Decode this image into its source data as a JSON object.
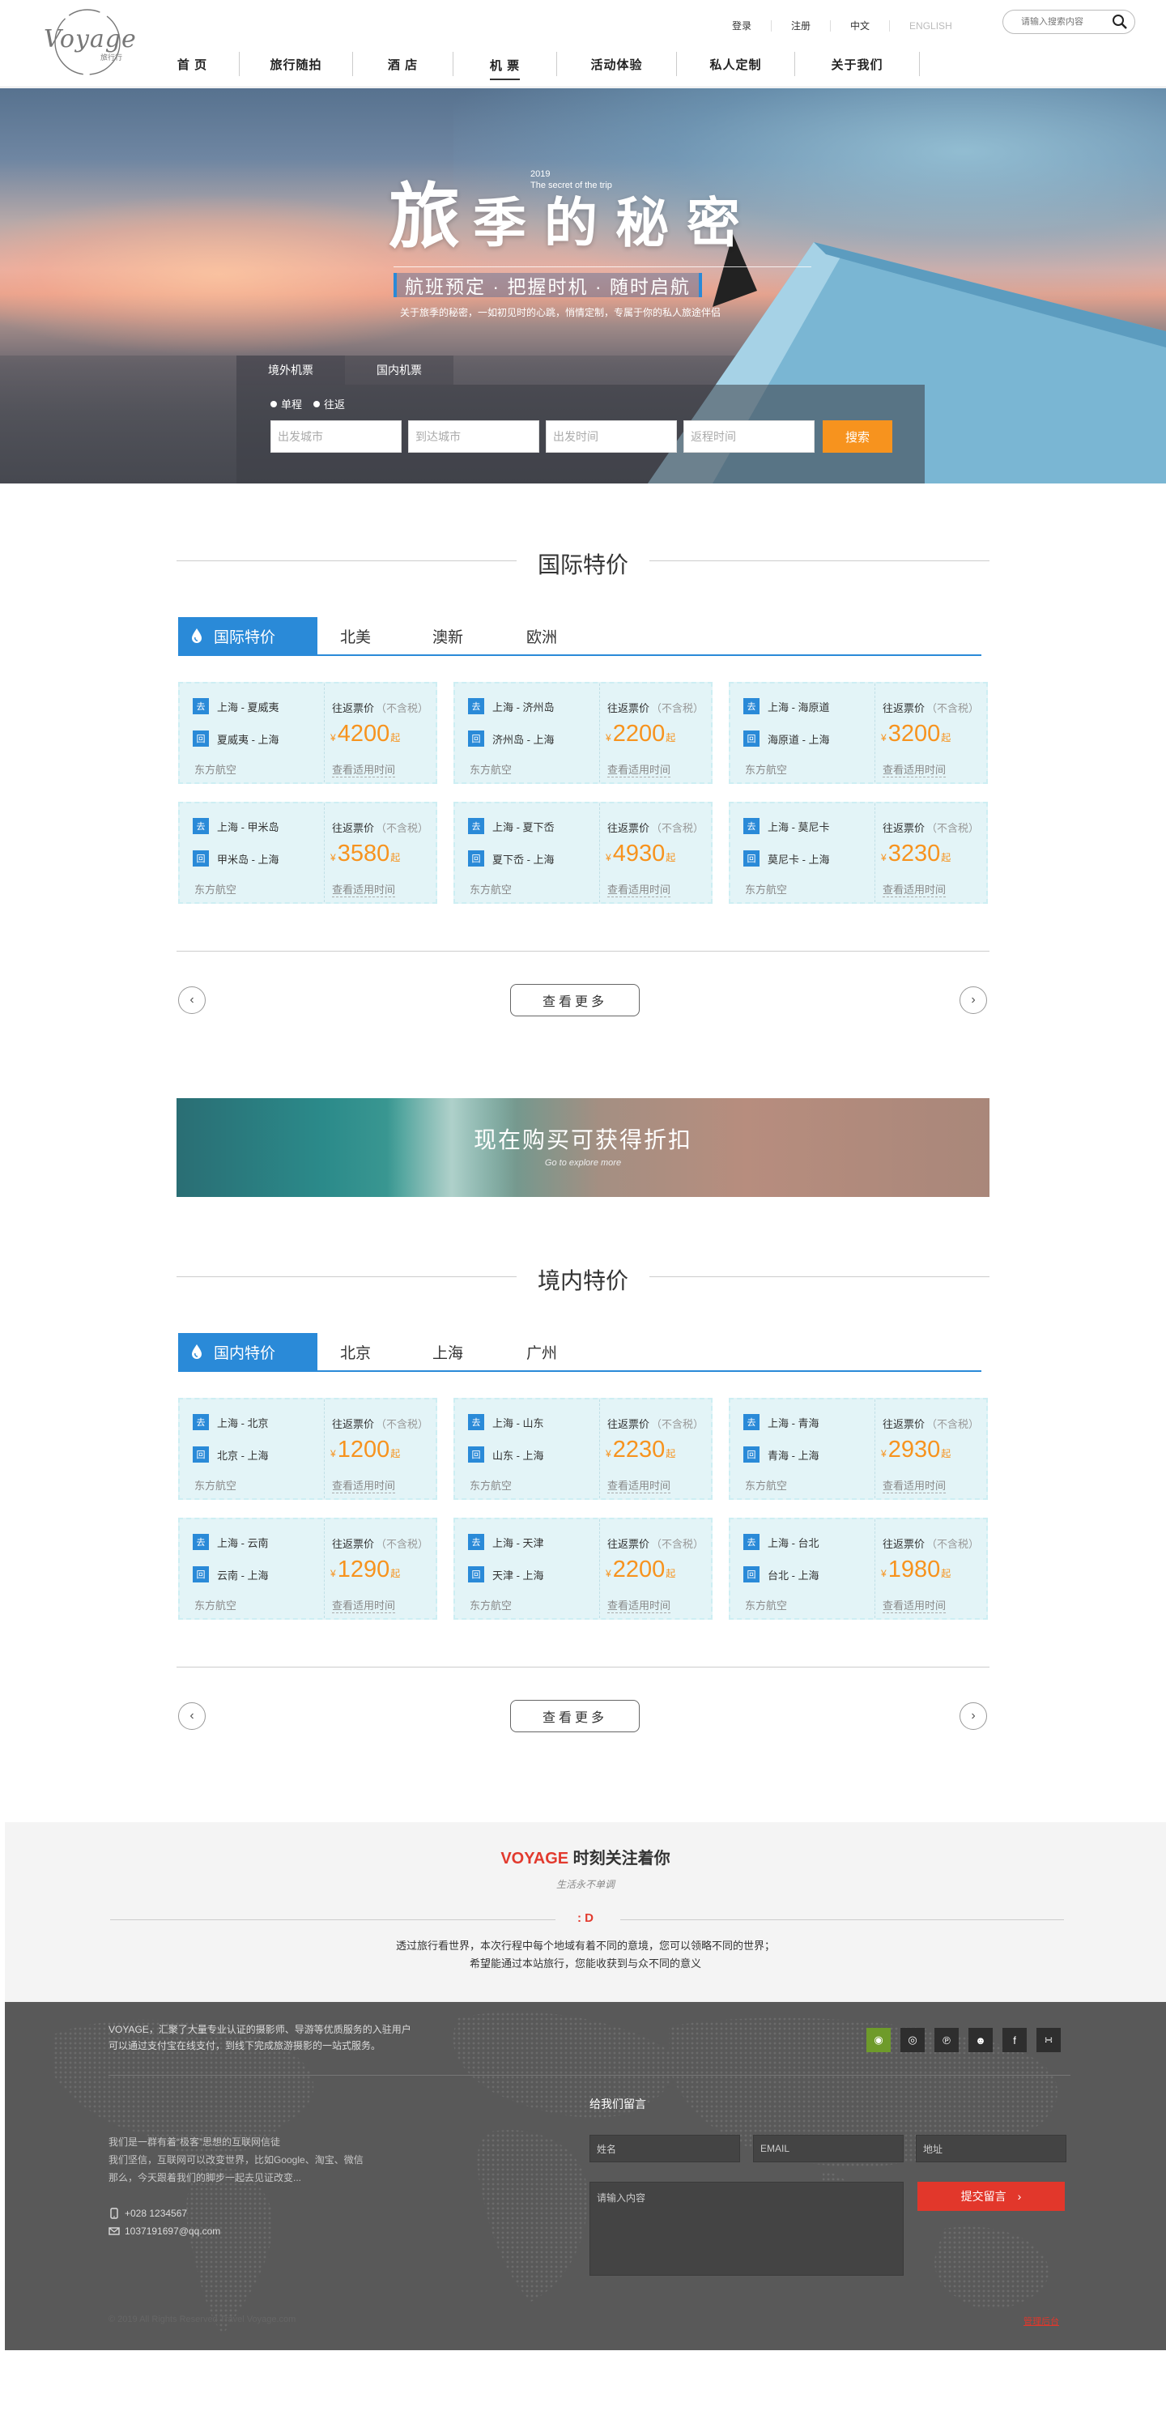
{
  "header": {
    "logo_text": "VOYAGE",
    "logo_sub": "旅行行",
    "top_links": [
      "登录",
      "注册",
      "中文",
      "ENGLISH"
    ],
    "search_placeholder": "请输入搜索内容",
    "nav": [
      "首  页",
      "旅行随拍",
      "酒  店",
      "机  票",
      "活动体验",
      "私人定制",
      "关于我们"
    ],
    "nav_active_index": 3
  },
  "hero": {
    "year": "2019",
    "subtitle_en": "The secret of the trip",
    "title_big": "旅",
    "title_rest": "季的秘密",
    "slogan": "航班预定 · 把握时机 · 随时启航",
    "desc": "关于旅季的秘密，一如初见时的心跳，悄情定制，专属于你的私人旅途伴侣",
    "booking_tabs": [
      "境外机票",
      "国内机票"
    ],
    "radios": [
      "单程",
      "往返"
    ],
    "inputs": [
      "出发城市",
      "到达城市",
      "出发时间",
      "返程时间"
    ],
    "search_button": "搜索"
  },
  "international": {
    "title": "国际特价",
    "tabs": [
      "国际特价",
      "北美",
      "澳新",
      "欧洲"
    ],
    "price_label": "往返票价",
    "tax_note": "（不含税）",
    "check_label": "查看适用时间",
    "go_badge": "去",
    "back_badge": "回",
    "yen": "¥",
    "qi": "起",
    "cards": [
      {
        "go": "上海 - 夏威夷",
        "back": "夏威夷 - 上海",
        "price": "4200",
        "airline": "东方航空"
      },
      {
        "go": "上海 - 济州岛",
        "back": "济州岛 - 上海",
        "price": "2200",
        "airline": "东方航空"
      },
      {
        "go": "上海 - 海原道",
        "back": "海原道 - 上海",
        "price": "3200",
        "airline": "东方航空"
      },
      {
        "go": "上海 - 甲米岛",
        "back": "甲米岛 - 上海",
        "price": "3580",
        "airline": "东方航空"
      },
      {
        "go": "上海 - 夏下岙",
        "back": "夏下岙 - 上海",
        "price": "4930",
        "airline": "东方航空"
      },
      {
        "go": "上海 - 莫尼卡",
        "back": "莫尼卡 - 上海",
        "price": "3230",
        "airline": "东方航空"
      }
    ],
    "more": "查看更多"
  },
  "banner": {
    "title": "现在购买可获得折扣",
    "sub": "Go to explore more"
  },
  "domestic": {
    "title": "境内特价",
    "tabs": [
      "国内特价",
      "北京",
      "上海",
      "广州"
    ],
    "cards": [
      {
        "go": "上海 - 北京",
        "back": "北京 - 上海",
        "price": "1200",
        "airline": "东方航空"
      },
      {
        "go": "上海 - 山东",
        "back": "山东 - 上海",
        "price": "2230",
        "airline": "东方航空"
      },
      {
        "go": "上海 - 青海",
        "back": "青海 - 上海",
        "price": "2930",
        "airline": "东方航空"
      },
      {
        "go": "上海 - 云南",
        "back": "云南 - 上海",
        "price": "1290",
        "airline": "东方航空"
      },
      {
        "go": "上海 - 天津",
        "back": "天津 - 上海",
        "price": "2200",
        "airline": "东方航空"
      },
      {
        "go": "上海 - 台北",
        "back": "台北 - 上海",
        "price": "1980",
        "airline": "东方航空"
      }
    ],
    "more": "查看更多"
  },
  "follow": {
    "brand": "VOYAGE",
    "title_rest": " 时刻关注着你",
    "sub": "生活永不单调",
    "deco": ": D",
    "p1": "透过旅行看世界，本次行程中每个地域有着不同的意境，您可以领略不同的世界；",
    "p2": "希望能通过本站旅行，您能收获到与众不同的意义"
  },
  "footer": {
    "about": "VOYAGE，汇聚了大量专业认证的摄影师、导游等优质服务的入驻用户可以通过支付宝在线支付，到线下完成旅游摄影的一站式服务。",
    "info_lines": [
      "我们是一群有着“极客”思想的互联网信徒",
      "我们坚信，互联网可以改变世界，比如Google、淘宝、微信",
      "那么，今天跟着我们的脚步一起去见证改变..."
    ],
    "phone": "+028 1234567",
    "email": "1037191697@qq.com",
    "social_icons": [
      "weibo-icon",
      "wechat-icon",
      "pinterest-icon",
      "qq-icon",
      "facebook-icon",
      "rss-icon"
    ],
    "message_title": "给我们留言",
    "name_placeholder": "姓名",
    "email_placeholder": "EMAIL",
    "address_placeholder": "地址",
    "content_placeholder": "请输入内容",
    "submit": "提交留言",
    "copyright": "© 2019 All Rights Reserved Travel Voyage.com",
    "admin": "管理后台"
  }
}
